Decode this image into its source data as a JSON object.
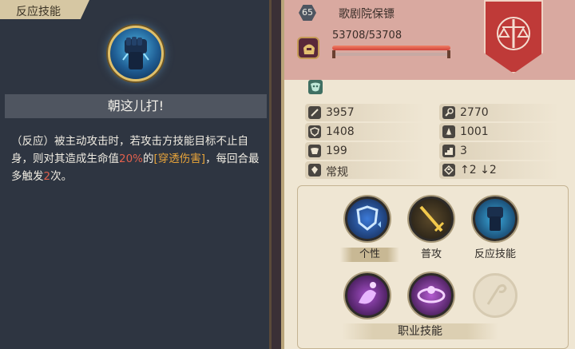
{
  "left_panel": {
    "tab_label": "反应技能",
    "skill_icon": "raised-fist-icon",
    "skill_name": "朝这儿打!",
    "description": {
      "part1": "（反应）被主动攻击时，若攻击方技能目标不止自身，则对其造成生命值",
      "percent": "20%",
      "part2": "的",
      "damage_type": "[穿透伤害]",
      "part3": "，每回合最多触发",
      "count": "2",
      "part4": "次。"
    }
  },
  "unit": {
    "level": "65",
    "name": "歌剧院保镖",
    "hp_text": "53708/53708",
    "hp_fraction": 1.0,
    "class_icon": "helmet-icon",
    "faction_icon": "scales-crest-icon",
    "status_icon": "mask-icon"
  },
  "stats": [
    {
      "icon": "sword-icon",
      "value": "3957"
    },
    {
      "icon": "magic-wand-icon",
      "value": "2770"
    },
    {
      "icon": "shield-icon",
      "value": "1408"
    },
    {
      "icon": "wizard-hat-icon",
      "value": "1001"
    },
    {
      "icon": "boot-icon",
      "value": "199"
    },
    {
      "icon": "stairs-icon",
      "value": "3"
    },
    {
      "icon": "movement-icon",
      "value": "常规"
    },
    {
      "icon": "jump-icon",
      "value": "↑2 ↓2"
    }
  ],
  "skills": {
    "row1": [
      {
        "label": "个性",
        "icon": "shield-buff-icon",
        "active": true
      },
      {
        "label": "普攻",
        "icon": "golden-sword-icon",
        "active": false
      },
      {
        "label": "反应技能",
        "icon": "raised-fist-icon",
        "active": false
      }
    ],
    "row2": [
      {
        "label": "",
        "icon": "purple-mask-icon",
        "active": false
      },
      {
        "label": "",
        "icon": "purple-dancer-icon",
        "active": false
      },
      {
        "label": "",
        "icon": "locked-skill-icon",
        "active": false
      }
    ],
    "class_skills_label": "职业技能"
  },
  "colors": {
    "left_bg": "#2e3541",
    "right_bg": "#efe6d3",
    "header_bg": "#d9a9a0",
    "crest_red": "#bf3a38",
    "highlight_red": "#e0604d",
    "highlight_gold": "#e8a43a"
  }
}
